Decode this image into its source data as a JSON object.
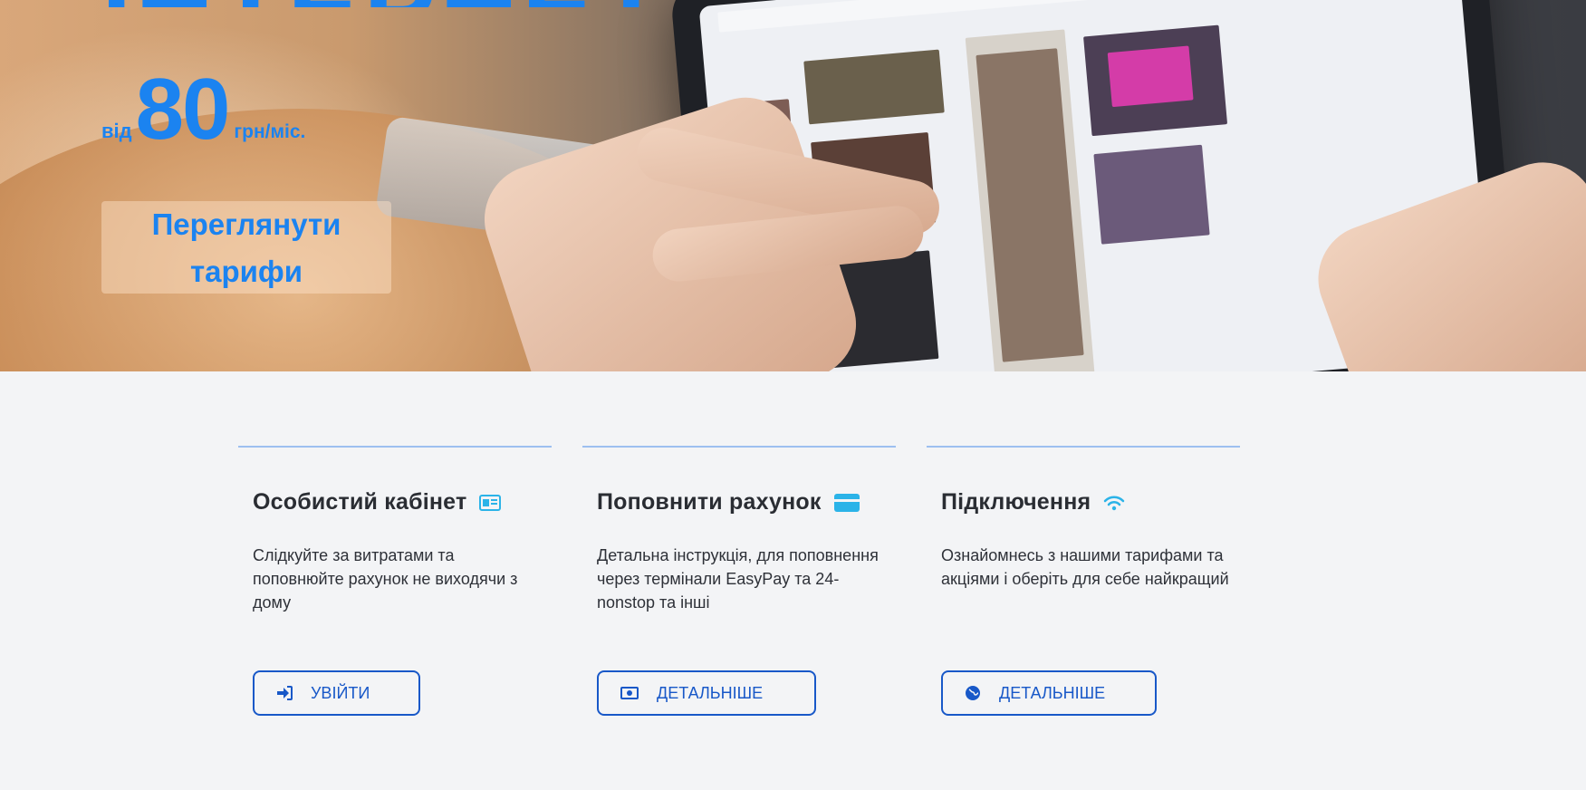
{
  "hero": {
    "title": "ІНТЕРНЕТ",
    "price": {
      "prefix": "від",
      "amount": "80",
      "unit": "грн/міс."
    },
    "cta_line1": "Переглянути",
    "cta_line2": "тарифи"
  },
  "features": [
    {
      "title": "Особистий кабінет",
      "icon": "id-card-icon",
      "text": "Слідкуйте за витратами та поповнюйте рахунок не виходячи з дому",
      "button_label": "УВІЙТИ",
      "button_icon": "sign-in-icon"
    },
    {
      "title": "Поповнити рахунок",
      "icon": "credit-card-icon",
      "text": "Детальна інструкція, для поповнення через термінали EasyPay та 24-nonstop та інші",
      "button_label": "ДЕТАЛЬНІШЕ",
      "button_icon": "money-bill-icon"
    },
    {
      "title": "Підключення",
      "icon": "wifi-icon",
      "text": "Ознайомнесь з нашими тарифами та акціями і оберіть для себе найкращий",
      "button_label": "ДЕТАЛЬНІШЕ",
      "button_icon": "globe-icon"
    }
  ],
  "colors": {
    "accent": "#1b83f0",
    "button_border": "#1858c8",
    "icon_teal": "#2bb3e8",
    "divider": "#9dbff0",
    "background": "#f3f4f6"
  }
}
